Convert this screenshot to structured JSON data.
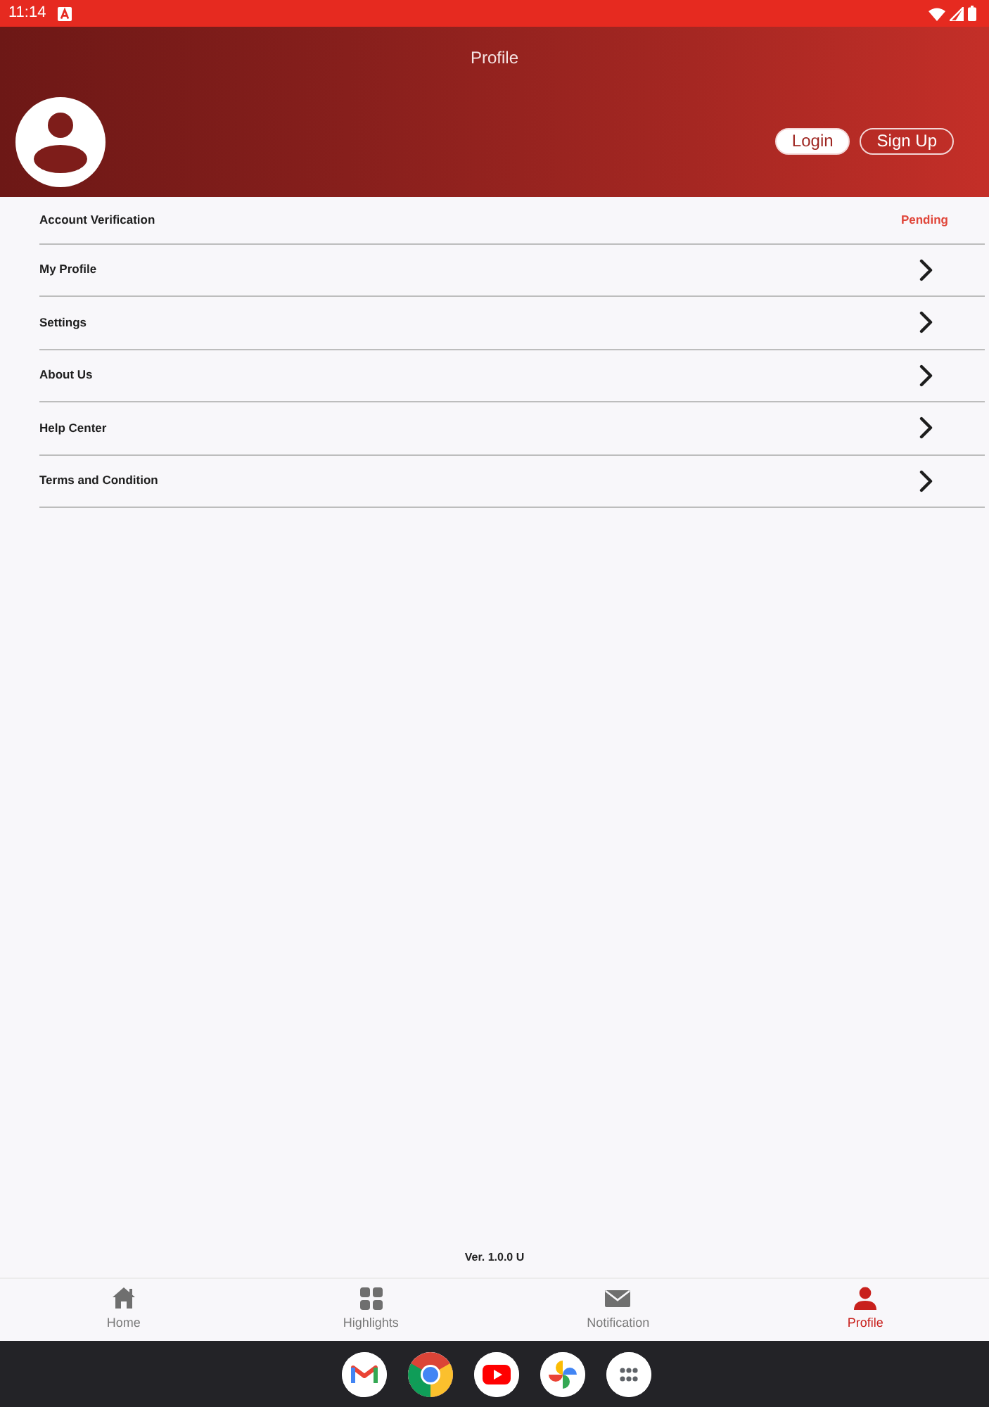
{
  "status_bar": {
    "time": "11:14"
  },
  "header": {
    "title": "Profile",
    "buttons": [
      {
        "label": "Login",
        "kind": "filled"
      },
      {
        "label": "Sign Up",
        "kind": "outline"
      }
    ]
  },
  "menu": [
    {
      "label": "Account Verification",
      "kind": "status",
      "status": "Pending"
    },
    {
      "label": "My Profile",
      "kind": "link"
    },
    {
      "label": "Settings",
      "kind": "link"
    },
    {
      "label": "About Us",
      "kind": "link"
    },
    {
      "label": "Help Center",
      "kind": "link"
    },
    {
      "label": "Terms and Condition",
      "kind": "link"
    }
  ],
  "version": "Ver. 1.0.0 U",
  "bottom_nav": [
    {
      "label": "Home",
      "selected": false
    },
    {
      "label": "Highlights",
      "selected": false
    },
    {
      "label": "Notification",
      "selected": false
    },
    {
      "label": "Profile",
      "selected": true
    }
  ]
}
